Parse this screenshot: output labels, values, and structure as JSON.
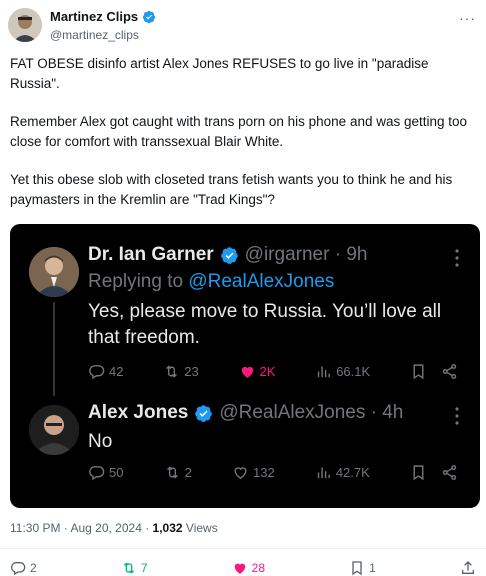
{
  "post": {
    "author_name": "Martinez Clips",
    "author_handle": "@martinez_clips",
    "more_label": "···",
    "paragraphs": [
      "FAT OBESE disinfo artist Alex Jones REFUSES to go live in \"paradise Russia\".",
      "Remember Alex got caught with trans porn on his phone and was getting too close for comfort with transsexual Blair White.",
      "Yet this obese slob with closeted trans fetish wants you to think he and his paymasters in the Kremlin are \"Trad Kings\"?"
    ],
    "timestamp": "11:30 PM · Aug 20, 2024 · ",
    "views_count": "1,032",
    "views_label": " Views",
    "actions": {
      "replies": "2",
      "reposts": "7",
      "likes": "28",
      "bookmarks": "1"
    }
  },
  "quoted": {
    "tweet1": {
      "name": "Dr. Ian Garner",
      "handle": "@irgarner · 9h",
      "replying_prefix": "Replying to ",
      "replying_mention": "@RealAlexJones",
      "text": "Yes, please move to Russia. You’ll love all that freedom.",
      "replies": "42",
      "reposts": "23",
      "likes": "2K",
      "views": "66.1K"
    },
    "tweet2": {
      "name": "Alex Jones",
      "handle": "@RealAlexJones · 4h",
      "text": "No",
      "replies": "50",
      "reposts": "2",
      "likes": "132",
      "views": "42.7K"
    }
  },
  "colors": {
    "verified": "#1d9bf0",
    "like_pink": "#f91880",
    "repost_green": "#00ba7c"
  }
}
